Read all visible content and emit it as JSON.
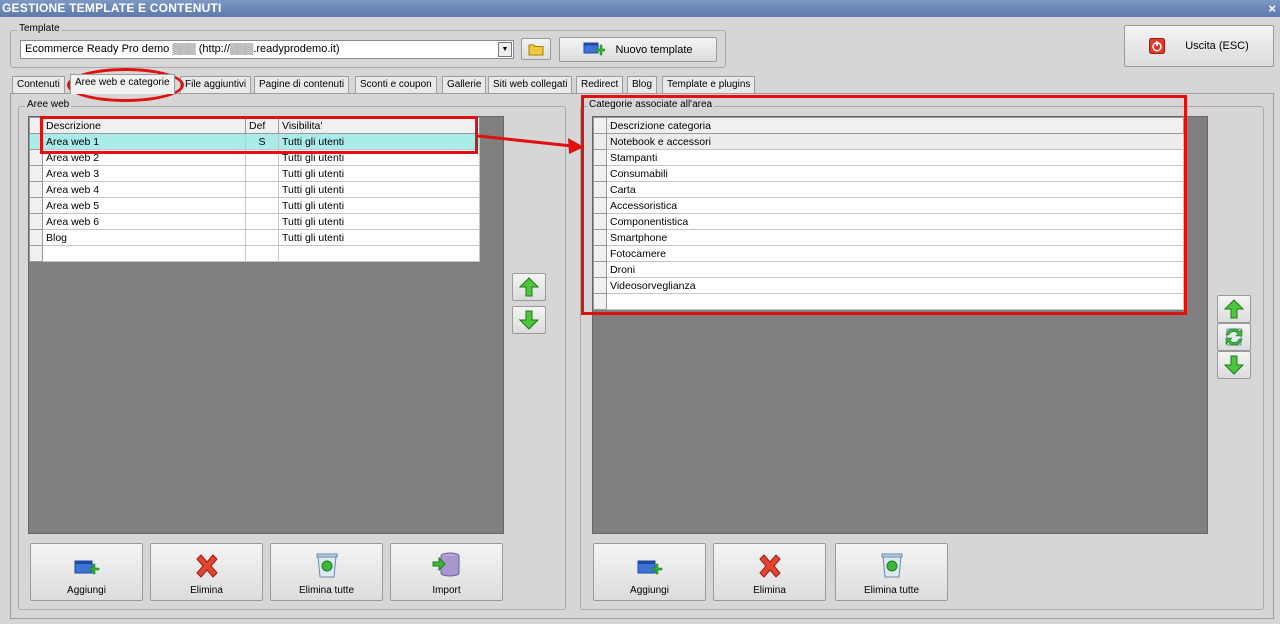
{
  "window": {
    "title": "GESTIONE TEMPLATE E CONTENUTI",
    "close": "×"
  },
  "template_group": {
    "label": "Template",
    "selected": "Ecommerce Ready Pro demo ▒▒▒ (http://▒▒▒.readyprodemo.it)",
    "new_template": "Nuovo template"
  },
  "exit_button": "Uscita (ESC)",
  "tabs": [
    {
      "label": "Contenuti"
    },
    {
      "label": "Aree web e categorie",
      "active": true
    },
    {
      "label": "File aggiuntivi"
    },
    {
      "label": "Pagine di contenuti"
    },
    {
      "label": "Sconti e coupon"
    },
    {
      "label": "Gallerie"
    },
    {
      "label": "Siti web collegati"
    },
    {
      "label": "Redirect"
    },
    {
      "label": "Blog"
    },
    {
      "label": "Template e plugins"
    }
  ],
  "aree_web": {
    "label": "Aree web",
    "columns": [
      "Descrizione",
      "Def",
      "Visibilita'"
    ],
    "rows": [
      {
        "descrizione": "Area web 1",
        "def": "S",
        "visibilita": "Tutti gli utenti",
        "selected": true
      },
      {
        "descrizione": "Area web 2",
        "def": "",
        "visibilita": "Tutti gli utenti"
      },
      {
        "descrizione": "Area web 3",
        "def": "",
        "visibilita": "Tutti gli utenti"
      },
      {
        "descrizione": "Area web 4",
        "def": "",
        "visibilita": "Tutti gli utenti"
      },
      {
        "descrizione": "Area web 5",
        "def": "",
        "visibilita": "Tutti gli utenti"
      },
      {
        "descrizione": "Area web 6",
        "def": "",
        "visibilita": "Tutti gli utenti"
      },
      {
        "descrizione": "Blog",
        "def": "",
        "visibilita": "Tutti gli utenti"
      },
      {
        "descrizione": "",
        "def": "",
        "visibilita": ""
      }
    ],
    "buttons": [
      "Aggiungi",
      "Elimina",
      "Elimina tutte",
      "Import"
    ]
  },
  "categorie": {
    "label": "Categorie associate all'area",
    "column": "Descrizione categoria",
    "rows": [
      "Notebook e accessori",
      "Stampanti",
      "Consumabili",
      "Carta",
      "Accessoristica",
      "Componentistica",
      "Smartphone",
      "Fotocamere",
      "Droni",
      "Videosorveglianza",
      ""
    ],
    "buttons": [
      "Aggiungi",
      "Elimina",
      "Elimina tutte"
    ]
  },
  "colors": {
    "highlight": "#e01010",
    "selected_row": "#a9ece9",
    "grid_bg": "#808080",
    "title_bar": "#6c88b8"
  }
}
